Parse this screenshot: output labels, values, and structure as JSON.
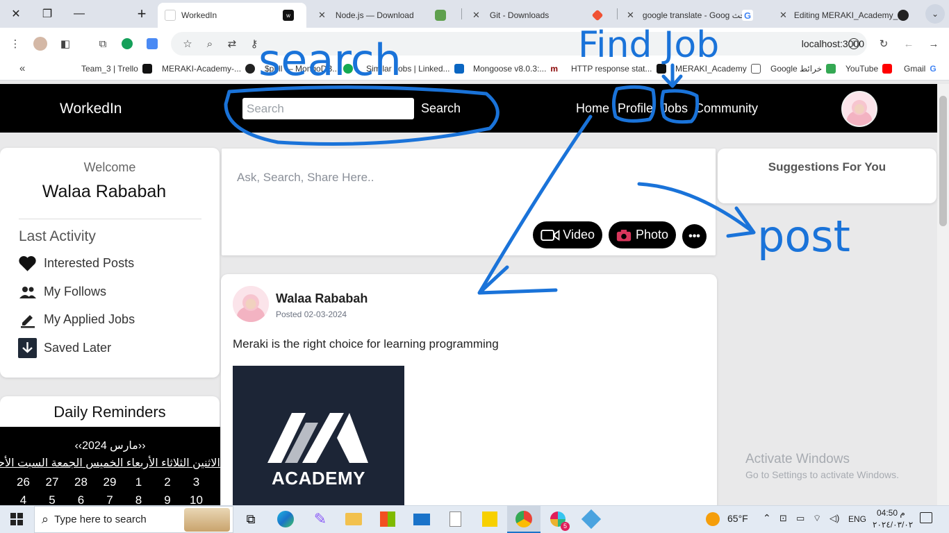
{
  "browser": {
    "window_controls": {
      "close": "✕",
      "restore": "❐",
      "minimize": "—",
      "new_tab": "+"
    },
    "tabs": [
      {
        "title": "WorkedIn",
        "active": true
      },
      {
        "title": "Node.js — Download"
      },
      {
        "title": "Git - Downloads"
      },
      {
        "title": "google translate - Goog بحث"
      },
      {
        "title": "Editing MERAKI_Academy_P"
      }
    ],
    "address": "localhost:3000",
    "bookmarks": [
      "Team_3 | Trello",
      "MERAKI-Academy-...",
      "$pull — MongoDB...",
      "Similar Jobs | Linked...",
      "Mongoose v8.0.3:...",
      "HTTP response stat...",
      "MERAKI_Academy",
      "Google خرائط",
      "YouTube",
      "Gmail"
    ]
  },
  "navbar": {
    "brand": "WorkedIn",
    "search_placeholder": "Search",
    "search_button": "Search",
    "links": [
      "Home",
      "Profile",
      "Jobs",
      "Community"
    ]
  },
  "sidebar": {
    "welcome": "Welcome",
    "user_name": "Walaa Rababah",
    "last_activity_title": "Last Activity",
    "items": [
      {
        "label": "Interested Posts",
        "icon": "heart-icon"
      },
      {
        "label": "My Follows",
        "icon": "people-icon"
      },
      {
        "label": "My Applied Jobs",
        "icon": "pen-icon"
      },
      {
        "label": "Saved Later",
        "icon": "download-icon"
      }
    ]
  },
  "reminders": {
    "title": "Daily Reminders",
    "calendar": {
      "header": "‹‹مارس 2024››",
      "weekdays": "الاثنين الثلاثاء الأربعاء الخميس الجمعة السبت الأحد",
      "rows": [
        [
          "26",
          "27",
          "28",
          "29",
          "1",
          "2",
          "3"
        ],
        [
          "4",
          "5",
          "6",
          "7",
          "8",
          "9",
          "10"
        ]
      ]
    }
  },
  "composer": {
    "placeholder": "Ask, Search, Share Here..",
    "video_button": "Video",
    "photo_button": "Photo",
    "more_button": "•••"
  },
  "post": {
    "author": "Walaa Rababah",
    "date": "Posted 02-03-2024",
    "text": "Meraki is the right choice for learning programming",
    "image_caption": "ACADEMY"
  },
  "suggestions": {
    "title": "Suggestions For You"
  },
  "watermark": {
    "line1": "Activate Windows",
    "line2": "Go to Settings to activate Windows."
  },
  "annotations": {
    "search": "search",
    "find_job": "Find Job",
    "post": "post"
  },
  "taskbar": {
    "search_placeholder": "Type here to search",
    "temperature": "65°F",
    "language": "ENG",
    "time": "04:50 م",
    "date": "٢٠٢٤/٠٣/٠٢",
    "notification_badge": "5"
  },
  "colors": {
    "navbar_bg": "#000000",
    "page_bg": "#e9e9ea",
    "annotation_ink": "#1a73d9"
  }
}
